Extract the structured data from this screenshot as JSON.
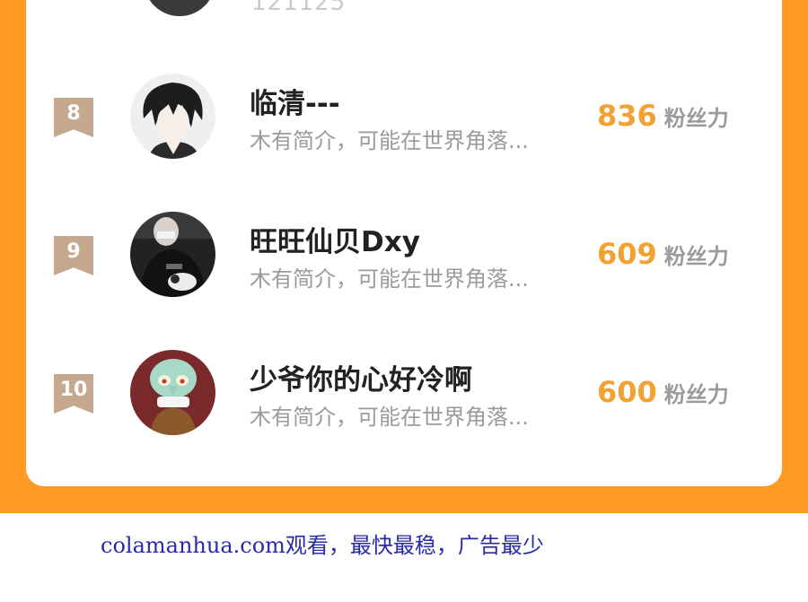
{
  "partial_row": {
    "fans_count": "121125"
  },
  "rows": [
    {
      "rank": "8",
      "name": "临清---",
      "bio": "木有简介，可能在世界角落...",
      "fans": "836",
      "fans_label": "粉丝力",
      "avatar": "anime-boy-avatar"
    },
    {
      "rank": "9",
      "name": "旺旺仙贝Dxy",
      "bio": "木有简介，可能在世界角落...",
      "fans": "609",
      "fans_label": "粉丝力",
      "avatar": "person-with-cat-avatar"
    },
    {
      "rank": "10",
      "name": "少爷你的心好冷啊",
      "bio": "木有简介，可能在世界角落...",
      "fans": "600",
      "fans_label": "粉丝力",
      "avatar": "squidward-avatar"
    }
  ],
  "footer": {
    "text": "colamanhua.com观看，最快最稳，广告最少"
  },
  "colors": {
    "frame": "#ff9a23",
    "fans_number": "#f2a233",
    "rank_badge": "#c5a88e",
    "footer_link": "#2a2aa8"
  }
}
